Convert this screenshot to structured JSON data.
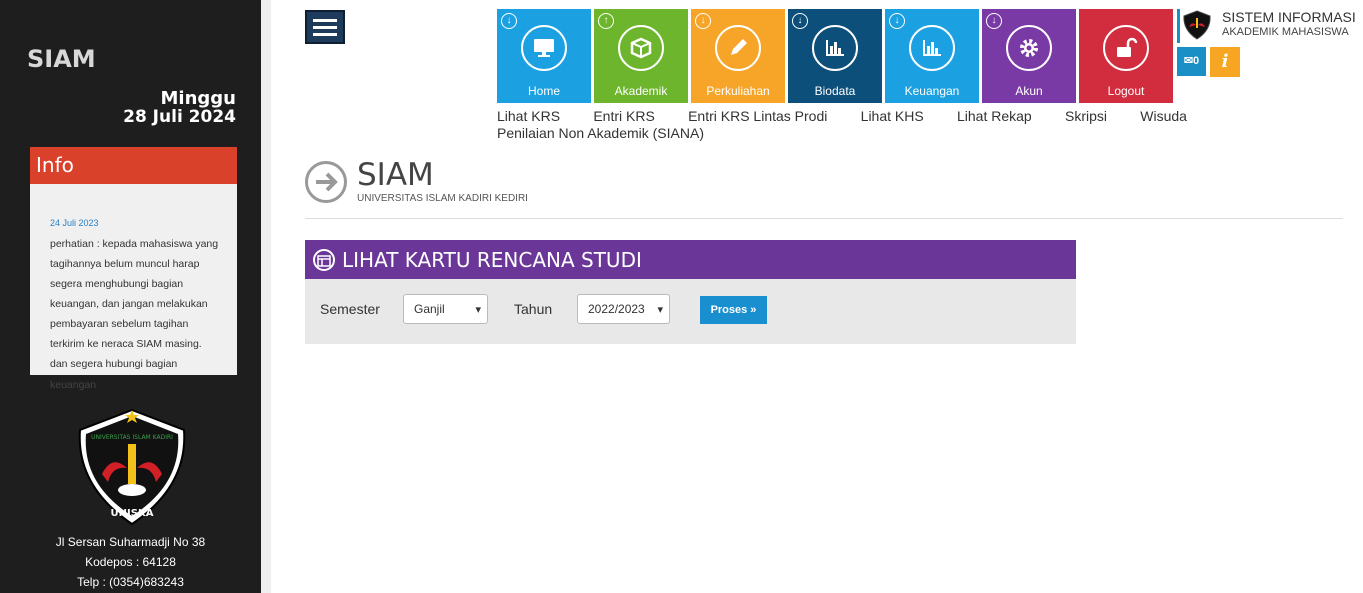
{
  "sidebar": {
    "app_name": "SIAM",
    "day": "Minggu",
    "date": "28 Juli 2024",
    "info": {
      "title": "Info",
      "date": "24 Juli 2023",
      "text": "perhatian : kepada mahasiswa yang tagihannya belum muncul harap segera menghubungi bagian keuangan, dan jangan melakukan pembayaran sebelum tagihan terkirim ke neraca SIAM masing. dan segera hubungi bagian",
      "overflow_text": "keuangan"
    },
    "logo_text": "UNISKA",
    "logo_arc_text": "UNIVERSITAS ISLAM KADIRI",
    "address": [
      "Jl Sersan Suharmadji No 38",
      "Kodepos : 64128",
      "Telp : (0354)683243"
    ]
  },
  "tiles": [
    {
      "label": "Home",
      "color": "#1ba1e2",
      "icon": "monitor-icon",
      "arrow": "down"
    },
    {
      "label": "Akademik",
      "color": "#6cb52d",
      "icon": "box-icon",
      "arrow": "up"
    },
    {
      "label": "Perkuliahan",
      "color": "#f7a528",
      "icon": "pen-icon",
      "arrow": "down"
    },
    {
      "label": "Biodata",
      "color": "#0b4f7a",
      "icon": "chart-icon",
      "arrow": "down"
    },
    {
      "label": "Keuangan",
      "color": "#1ba1e2",
      "icon": "chart-icon",
      "arrow": "down"
    },
    {
      "label": "Akun",
      "color": "#7a3aa6",
      "icon": "gear-icon",
      "arrow": "down"
    },
    {
      "label": "Logout",
      "color": "#d12d3e",
      "icon": "unlock-icon",
      "arrow": ""
    }
  ],
  "brand": {
    "title": "SISTEM INFORMASI",
    "subtitle": "AKADEMIK MAHASISWA",
    "msg_count": "0",
    "info_glyph": "i"
  },
  "submenu": {
    "row1": [
      "Lihat KRS",
      "Entri KRS",
      "Entri KRS Lintas Prodi",
      "Lihat KHS",
      "Lihat Rekap",
      "Skripsi",
      "Wisuda"
    ],
    "row2": "Penilaian Non Akademik (SIANA)"
  },
  "page": {
    "title": "SIAM",
    "subtitle": "UNIVERSITAS ISLAM KADIRI KEDIRI"
  },
  "panel": {
    "title": "LIHAT KARTU RENCANA STUDI",
    "semester_label": "Semester",
    "semester_value": "Ganjil",
    "tahun_label": "Tahun",
    "tahun_value": "2022/2023",
    "button_label": "Proses »"
  }
}
